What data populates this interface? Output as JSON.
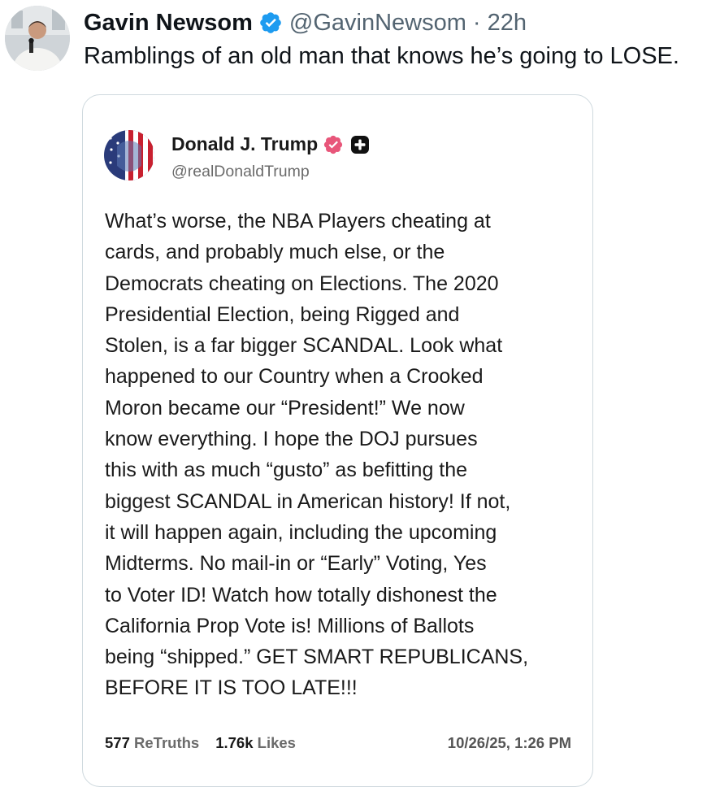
{
  "post": {
    "author": {
      "display_name": "Gavin Newsom",
      "handle": "@GavinNewsom",
      "separator": "·",
      "time": "22h",
      "verified_icon": "verified-check-icon",
      "verified_color": "#1d9bf0"
    },
    "text": "Ramblings of an old man that knows he’s going to LOSE."
  },
  "quoted": {
    "author": {
      "display_name": "Donald J. Trump",
      "handle": "@realDonaldTrump",
      "badge_icon": "verified-badge-icon",
      "badge_color": "#e8567a",
      "plus_icon": "plus-badge-icon"
    },
    "lines": [
      "What’s worse, the NBA Players cheating at",
      "cards, and probably much else, or the",
      "Democrats cheating on Elections. The 2020",
      "Presidential Election, being Rigged and",
      "Stolen, is a far bigger SCANDAL. Look what",
      "happened to our Country when a Crooked",
      "Moron became our “President!” We now",
      "know everything. I hope the DOJ pursues",
      "this with as much “gusto” as befitting the",
      "biggest SCANDAL in American history! If not,",
      "it will happen again, including the upcoming",
      "Midterms. No mail-in or “Early” Voting, Yes",
      "to Voter ID! Watch how totally dishonest the",
      "California Prop Vote is! Millions of Ballots",
      "being “shipped.” GET SMART REPUBLICANS,",
      "BEFORE IT IS TOO LATE!!!"
    ],
    "stats": {
      "retruths_count": "577",
      "retruths_label": "ReTruths",
      "likes_count": "1.76k",
      "likes_label": "Likes"
    },
    "date": "10/26/25, 1:26 PM"
  }
}
